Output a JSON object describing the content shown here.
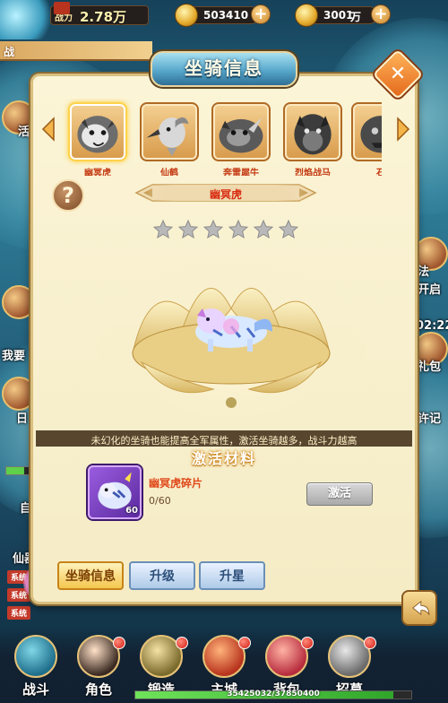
{
  "topbar": {
    "power_label": "战力",
    "power_value": "2.78万",
    "gold_value": "503410",
    "coupon_value": "3001",
    "coupon_unit": "万"
  },
  "left_tab": "战",
  "panel": {
    "title": "坐骑信息",
    "close_icon": "✕",
    "mounts": [
      {
        "name": "幽冥虎",
        "selected": true
      },
      {
        "name": "仙鹤",
        "selected": false
      },
      {
        "name": "奔雷犀牛",
        "selected": false
      },
      {
        "name": "烈焰战马",
        "selected": false
      },
      {
        "name": "石",
        "selected": false
      }
    ],
    "help_label": "?",
    "selected_name": "幽冥虎",
    "stars_total": 6,
    "stars_lit": 0,
    "info_text": "未幻化的坐骑也能提高全军属性，激活坐骑越多，战斗力越高",
    "materials_title": "激活材料",
    "material": {
      "name": "幽冥虎碎片",
      "count": "0/60",
      "badge": "60"
    },
    "activate_label": "激活",
    "tabs": [
      {
        "label": "坐骑信息",
        "active": true
      },
      {
        "label": "升级",
        "active": false
      },
      {
        "label": "升星",
        "active": false
      }
    ]
  },
  "side_texts": {
    "left": [
      "活",
      "我要",
      "日",
      "自",
      "仙器"
    ],
    "right": [
      "法",
      "开启",
      "02:22",
      "礼包",
      "许记"
    ]
  },
  "chat": [
    "系统",
    "系统",
    "系统"
  ],
  "bottom_nav": [
    {
      "label": "战斗",
      "icon": "battle-icon"
    },
    {
      "label": "角色",
      "icon": "character-icon"
    },
    {
      "label": "锻造",
      "icon": "forge-icon"
    },
    {
      "label": "主城",
      "icon": "city-icon"
    },
    {
      "label": "背包",
      "icon": "bag-icon"
    },
    {
      "label": "招募",
      "icon": "recruit-icon"
    }
  ],
  "exp_text": "35425032/37850400",
  "exp_fraction": 0.936,
  "colors": {
    "accent_gold": "#f4c64e",
    "name_red": "#d82a10",
    "panel_bg": "#fbf4d6"
  }
}
